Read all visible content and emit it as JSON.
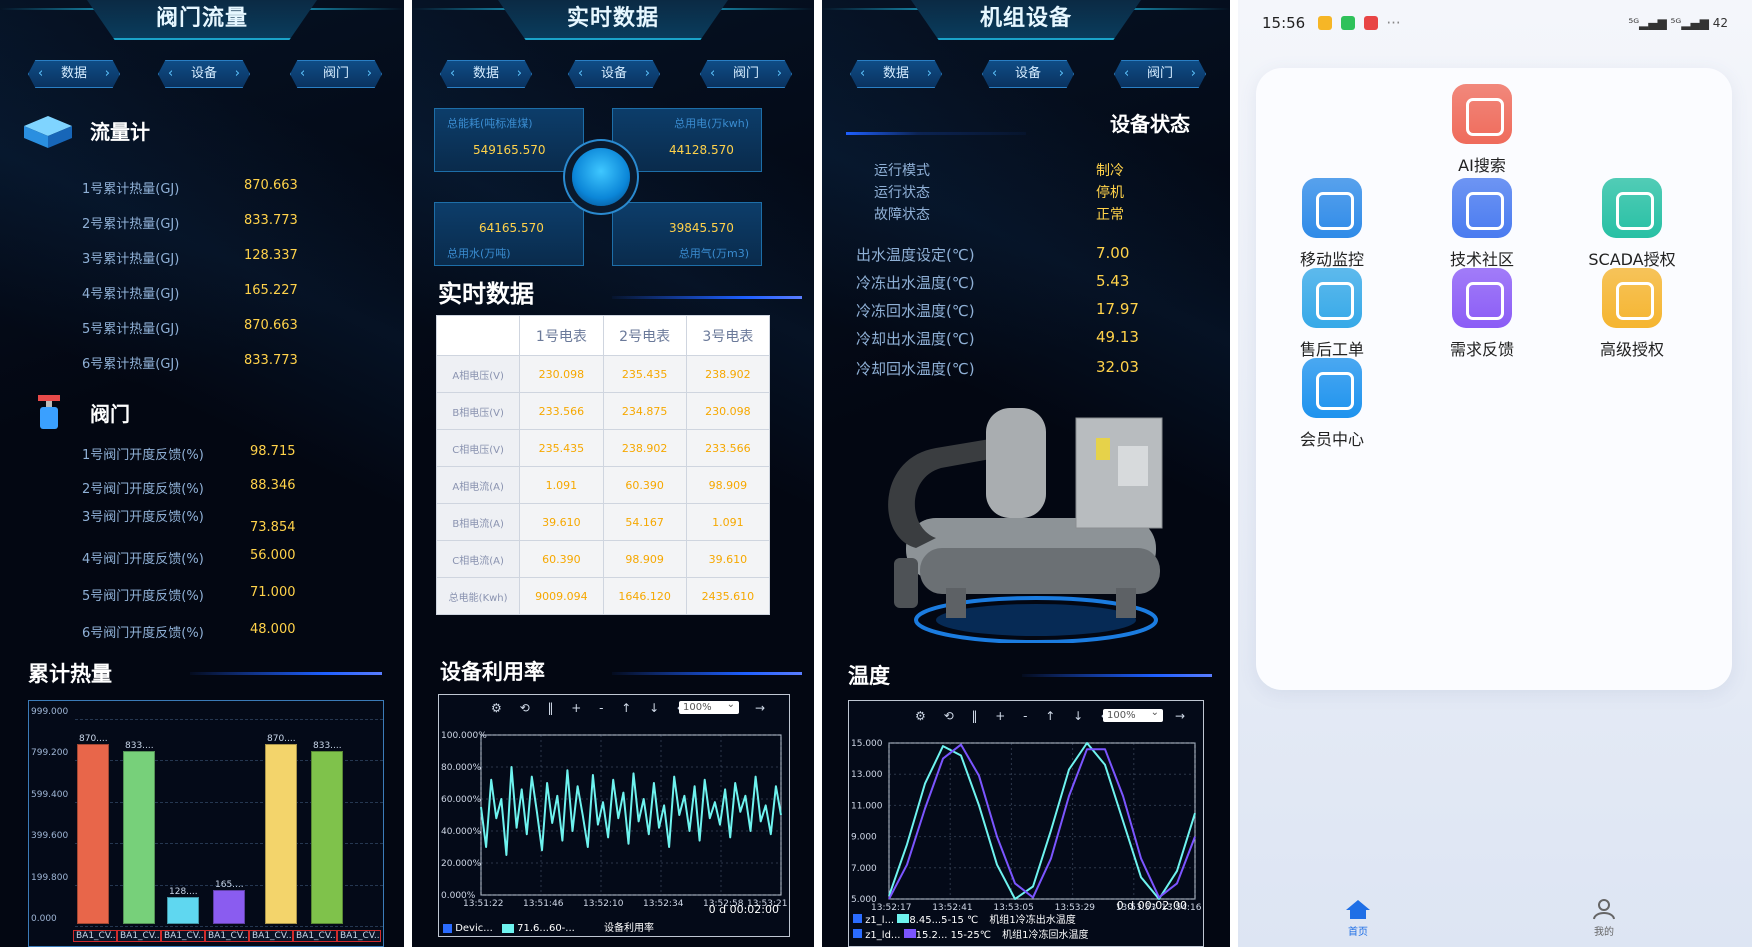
{
  "panel1": {
    "title": "阀门流量",
    "nav": [
      "数据",
      "设备",
      "阀门"
    ],
    "flow": {
      "title": "流量计",
      "items": [
        {
          "label": "1号累计热量(GJ)",
          "value": "870.663"
        },
        {
          "label": "2号累计热量(GJ)",
          "value": "833.773"
        },
        {
          "label": "3号累计热量(GJ)",
          "value": "128.337"
        },
        {
          "label": "4号累计热量(GJ)",
          "value": "165.227"
        },
        {
          "label": "5号累计热量(GJ)",
          "value": "870.663"
        },
        {
          "label": "6号累计热量(GJ)",
          "value": "833.773"
        }
      ]
    },
    "valve": {
      "title": "阀门",
      "items": [
        {
          "label": "1号阀门开度反馈(%)",
          "value": "98.715"
        },
        {
          "label": "2号阀门开度反馈(%)",
          "value": "88.346"
        },
        {
          "label": "3号阀门开度反馈(%)",
          "value": "73.854"
        },
        {
          "label": "4号阀门开度反馈(%)",
          "value": "56.000"
        },
        {
          "label": "5号阀门开度反馈(%)",
          "value": "71.000"
        },
        {
          "label": "6号阀门开度反馈(%)",
          "value": "48.000"
        }
      ]
    },
    "chart_title": "累计热量"
  },
  "panel2": {
    "title": "实时数据",
    "nav": [
      "数据",
      "设备",
      "阀门"
    ],
    "metrics": [
      {
        "label": "总能耗(吨标准煤)",
        "value": "549165.570"
      },
      {
        "label": "总用电(万kwh)",
        "value": "44128.570"
      },
      {
        "label": "总用水(万吨)",
        "value": "64165.570"
      },
      {
        "label": "总用气(万m3)",
        "value": "39845.570"
      }
    ],
    "table_title": "实时数据",
    "table": {
      "headers": [
        "",
        "1号电表",
        "2号电表",
        "3号电表"
      ],
      "rows": [
        [
          "A相电压(V)",
          "230.098",
          "235.435",
          "238.902"
        ],
        [
          "B相电压(V)",
          "233.566",
          "234.875",
          "230.098"
        ],
        [
          "C相电压(V)",
          "235.435",
          "238.902",
          "233.566"
        ],
        [
          "A相电流(A)",
          "1.091",
          "60.390",
          "98.909"
        ],
        [
          "B相电流(A)",
          "39.610",
          "54.167",
          "1.091"
        ],
        [
          "C相电流(A)",
          "60.390",
          "98.909",
          "39.610"
        ],
        [
          "总电能(Kwh)",
          "9009.094",
          "1646.120",
          "2435.610"
        ]
      ]
    },
    "trend_title": "设备利用率",
    "toolbar": "⚙ ⟲ ‖ + - ↑ ↓ ←",
    "zoom": "100%",
    "toolbar_next": "→",
    "duration": "0 d 00:02:00",
    "legend": [
      {
        "id": "Devic...",
        "name": "设备利用率"
      },
      {
        "range": "71.6...60-..."
      }
    ]
  },
  "panel3": {
    "title": "机组设备",
    "nav": [
      "数据",
      "设备",
      "阀门"
    ],
    "status_title": "设备状态",
    "status": [
      {
        "label": "运行模式",
        "value": "制冷"
      },
      {
        "label": "运行状态",
        "value": "停机"
      },
      {
        "label": "故障状态",
        "value": "正常"
      },
      {
        "label": "出水温度设定(℃)",
        "value": "7.00"
      },
      {
        "label": "冷冻出水温度(℃)",
        "value": "5.43"
      },
      {
        "label": "冷冻回水温度(℃)",
        "value": "17.97"
      },
      {
        "label": "冷却出水温度(℃)",
        "value": "49.13"
      },
      {
        "label": "冷却回水温度(℃)",
        "value": "32.03"
      }
    ],
    "trend_title": "温度",
    "toolbar": "⚙ ⟲ ‖ + - ↑ ↓ ←",
    "zoom": "100%",
    "toolbar_next": "→",
    "duration": "0 d 00:02:00",
    "legend": [
      {
        "id": "z1_l...",
        "range": "8.45...5-15 ℃",
        "name": "机组1冷冻出水温度"
      },
      {
        "id": "z1_ld...",
        "range": "15.2... 15-25℃",
        "name": "机组1冷冻回水温度"
      }
    ]
  },
  "phone": {
    "time": "15:56",
    "dots": "···",
    "signal": "⁵ᴳ▂▄▆ ⁵ᴳ▂▄▆ 42",
    "apps": [
      {
        "label": "AI搜索",
        "color": "#ef6b5b",
        "icon": "ai-search-icon"
      },
      {
        "label": "移动监控",
        "color": "#2f8be8",
        "icon": "monitor-icon"
      },
      {
        "label": "技术社区",
        "color": "#4a7bf0",
        "icon": "community-icon"
      },
      {
        "label": "SCADA授权",
        "color": "#27c0a4",
        "icon": "scada-icon"
      },
      {
        "label": "售后工单",
        "color": "#36a9e8",
        "icon": "work-order-icon"
      },
      {
        "label": "需求反馈",
        "color": "#8b5cf6",
        "icon": "feedback-icon"
      },
      {
        "label": "高级授权",
        "color": "#f5b530",
        "icon": "license-icon"
      },
      {
        "label": "会员中心",
        "color": "#1e93ee",
        "icon": "member-icon"
      }
    ],
    "tabs": [
      {
        "label": "首页",
        "icon": "home-icon"
      },
      {
        "label": "我的",
        "icon": "profile-icon"
      }
    ]
  },
  "chart_data": [
    {
      "type": "bar",
      "categories": [
        "BA1_CV...",
        "BA1_CV...",
        "BA1_CV...",
        "BA1_CV...",
        "BA1_CV...",
        "BA1_CV...",
        "BA1_CV..."
      ],
      "values": [
        870.663,
        833.773,
        128.337,
        165.227,
        870.663,
        833.773
      ],
      "value_labels": [
        "870....",
        "833....",
        "128....",
        "165....",
        "870....",
        "833...."
      ],
      "colors": [
        "#e8664a",
        "#77d07a",
        "#5fd7f0",
        "#8a5cf0",
        "#f3d46b",
        "#7fc24b"
      ],
      "yticks": [
        "999.000",
        "799.200",
        "599.400",
        "399.600",
        "199.800",
        "0.000"
      ],
      "ylim": [
        0,
        999
      ]
    },
    {
      "type": "line",
      "yticks": [
        "100.000%",
        "80.000%",
        "60.000%",
        "40.000%",
        "20.000%",
        "0.000%"
      ],
      "ylim": [
        0,
        100
      ],
      "xticks": [
        "13:51:22",
        "13:51:46",
        "13:52:10",
        "13:52:34",
        "13:52:58",
        "13:53:21"
      ],
      "series": [
        {
          "name": "设备利用率",
          "color": "#6ef3ef",
          "values": [
            55,
            30,
            72,
            48,
            60,
            25,
            80,
            42,
            66,
            38,
            74,
            52,
            28,
            70,
            45,
            62,
            34,
            78,
            40,
            68,
            50,
            30,
            75,
            44,
            58,
            36,
            72,
            48,
            64,
            32,
            76,
            46,
            60,
            38,
            70,
            42,
            56,
            30,
            74,
            50,
            62,
            40,
            68,
            34,
            72,
            48,
            58,
            44,
            66,
            36,
            70,
            52,
            62,
            40,
            74,
            46,
            56,
            38,
            68,
            50
          ]
        }
      ]
    },
    {
      "type": "line",
      "yticks": [
        "15.000",
        "13.000",
        "11.000",
        "9.000",
        "7.000",
        "5.000"
      ],
      "ylim": [
        5,
        15
      ],
      "xticks": [
        "13:52:17",
        "13:52:41",
        "13:53:05",
        "13:53:29",
        "13:53:53",
        "13:54:16"
      ],
      "series": [
        {
          "name": "机组1冷冻出水温度",
          "color": "#6ef3ef",
          "values": [
            5.2,
            8.5,
            12.4,
            14.8,
            14.2,
            11.0,
            7.2,
            5.0,
            5.8,
            9.4,
            13.3,
            15.0,
            13.6,
            10.0,
            6.4,
            5.0,
            6.8,
            10.5
          ]
        },
        {
          "name": "机组1冷冻回水温度",
          "color": "#7b55ff",
          "values": [
            5.0,
            7.2,
            10.8,
            14.0,
            14.9,
            12.9,
            9.0,
            6.0,
            5.1,
            7.6,
            11.6,
            14.6,
            14.6,
            11.6,
            7.6,
            5.1,
            6.0,
            9.0
          ]
        }
      ]
    }
  ]
}
